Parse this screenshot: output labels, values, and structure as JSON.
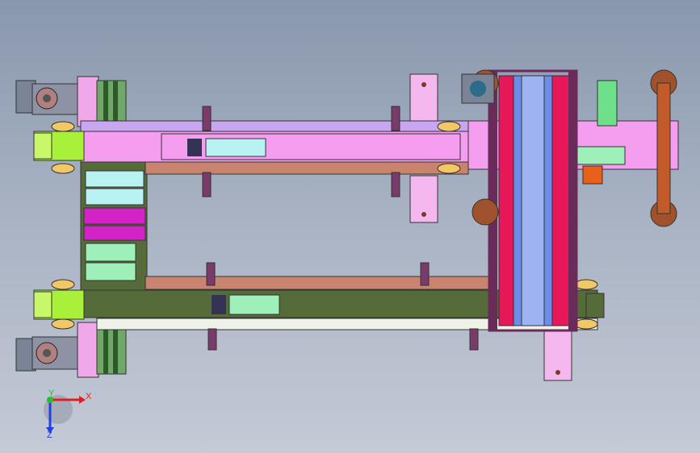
{
  "colors": {
    "viewport_top": "#8997ad",
    "viewport_bottom": "#c4cad6",
    "conveyor_pink": "#f59ef0",
    "conveyor_green": "#556b3a",
    "rail_lavender": "#c8a6f2",
    "rail_salmon": "#c98470",
    "end_cap_lime": "#a8f03a",
    "panel_cyan": "#b8f2f2",
    "panel_magenta": "#d323c6",
    "panel_mint": "#9ef0b8",
    "crimson_block": "#e8175a",
    "blue_belt": "#6d8ee6",
    "frame_purple": "#6a2a5a",
    "motor_slate": "#7a8496",
    "wheel_brown": "#a0522d"
  },
  "icons": [
    "triad-origin-icon",
    "motor-icon",
    "wheel-icon",
    "clamp-icon",
    "bolt-icon"
  ],
  "triad": {
    "x_label": "X",
    "y_label": "Y",
    "z_label": "Z",
    "x_color": "#e02020",
    "y_color": "#22c022",
    "z_color": "#2040e0"
  }
}
